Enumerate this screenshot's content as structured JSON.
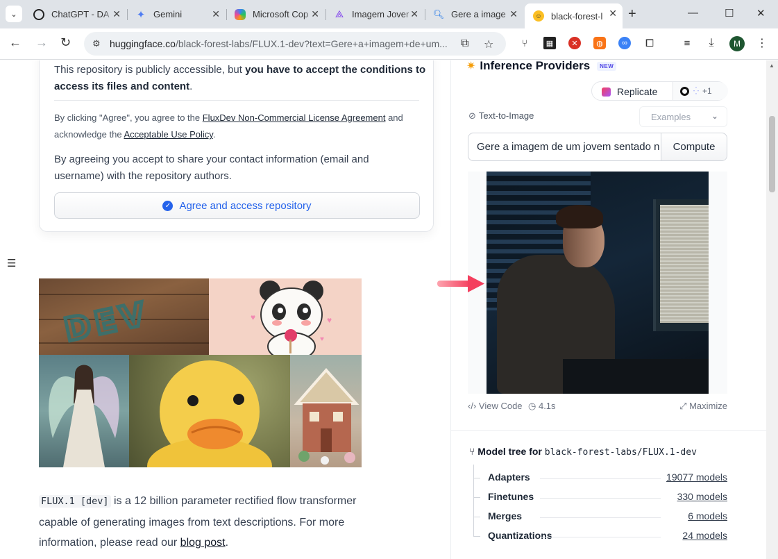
{
  "browser": {
    "tabs": [
      {
        "label": "ChatGPT - DA",
        "favicon": "chatgpt-icon",
        "color": "#000000"
      },
      {
        "label": "Gemini",
        "favicon": "gemini-icon",
        "color": "#4f7df3"
      },
      {
        "label": "Microsoft Cop",
        "favicon": "copilot-icon",
        "color": "#e67e22"
      },
      {
        "label": "Imagem Jover",
        "favicon": "sparkle-icon",
        "color": "#7c3aed"
      },
      {
        "label": "Gere a image",
        "favicon": "search-icon",
        "color": "#1a73e8"
      },
      {
        "label": "black-forest-l",
        "favicon": "hugging-face-icon",
        "color": "#fbbf24"
      }
    ],
    "url_host": "huggingface.co",
    "url_path": "/black-forest-labs/FLUX.1-dev?text=Gere+a+imagem+de+um...",
    "profile_initial": "M"
  },
  "gate": {
    "lead_plain": "This repository is publicly accessible, but ",
    "lead_bold": "you have to accept the conditions to access its files and content",
    "lead_end": ".",
    "agree_pre": "By clicking \"Agree\", you agree to the ",
    "license_link": "FluxDev Non-Commercial License Agreement",
    "agree_mid": " and acknowledge the ",
    "aup_link": "Acceptable Use Policy",
    "agree_end": ".",
    "share_text": "By agreeing you accept to share your contact information (email and username) with the repository authors.",
    "agree_button": "Agree and access repository"
  },
  "description": {
    "code": "FLUX.1 [dev]",
    "text": " is a 12 billion parameter rectified flow transformer capable of generating images from text descriptions. For more information, please read our ",
    "link": "blog post",
    "end": "."
  },
  "inference": {
    "title": "Inference Providers",
    "badge": "NEW",
    "provider": "Replicate",
    "more_count": "+1",
    "task": "Text-to-Image",
    "examples_placeholder": "Examples",
    "prompt_value": "Gere a imagem de um jovem sentado n",
    "compute_label": "Compute",
    "view_code": "View Code",
    "time": "4.1s",
    "maximize": "Maximize"
  },
  "model_tree": {
    "label": "Model tree for",
    "model_id": "black-forest-labs/FLUX.1-dev",
    "rows": [
      {
        "name": "Adapters",
        "count": "19077 models"
      },
      {
        "name": "Finetunes",
        "count": "330 models"
      },
      {
        "name": "Merges",
        "count": "6 models"
      },
      {
        "name": "Quantizations",
        "count": "24 models"
      }
    ]
  }
}
